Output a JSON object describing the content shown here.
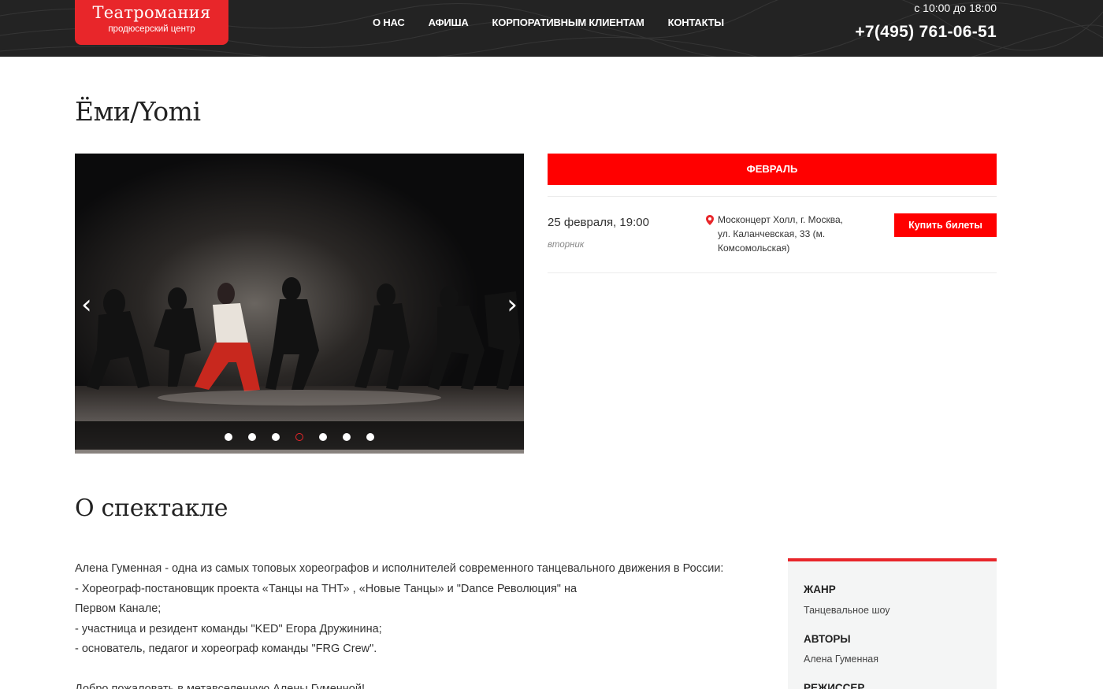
{
  "header": {
    "logo_name": "Театромания",
    "logo_sub": "продюсерский центр",
    "nav": [
      "О НАС",
      "АФИША",
      "КОРПОРАТИВНЫМ КЛИЕНТАМ",
      "КОНТАКТЫ"
    ],
    "hours": "с 10:00 до 18:00",
    "phone": "+7(495) 761-06-51"
  },
  "page_title": "Ёми/Yomi",
  "slider": {
    "prev_icon": "chevron-left-icon",
    "next_icon": "chevron-right-icon",
    "prev_glyph": "‹",
    "next_glyph": "›",
    "dot_count": 7,
    "active_dot": 4
  },
  "schedule": {
    "month": "ФЕВРАЛЬ",
    "event": {
      "date": "25 февраля, 19:00",
      "weekday": "вторник",
      "venue": "Москонцерт Холл, г. Москва, ул. Каланчевская, 33 (м. Комсомольская)",
      "buy_label": "Купить билеты"
    }
  },
  "about": {
    "title": "О спектакле",
    "lines": [
      "Алена Гуменная - одна из самых топовых хореографов и исполнителей современного танцевального движения в России:",
      "- Хореограф-постановщик проекта «Танцы на ТНТ» , «Новые Танцы» и \"Dance Революция\" на",
      "Первом Канале;",
      "- участница и резидент команды \"KED\" Егора Дружинина;",
      "- основатель, педагог и хореограф команды \"FRG Crew\".",
      "",
      "Добро пожаловать в метавселенную Алены Гуменной!"
    ]
  },
  "info": {
    "genre_label": "ЖАНР",
    "genre": "Танцевальное шоу",
    "authors_label": "АВТОРЫ",
    "authors": "Алена Гуменная",
    "director_label": "РЕЖИССЕР"
  },
  "colors": {
    "accent": "#ff0000",
    "logo_red": "#e8262a",
    "header_bg": "#232323"
  }
}
